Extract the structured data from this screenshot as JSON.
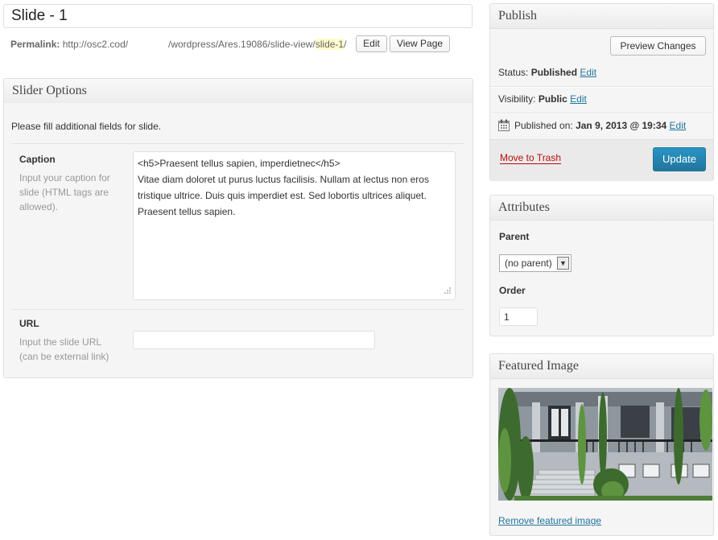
{
  "post": {
    "title": "Slide - 1",
    "permalink_label": "Permalink:",
    "permalink_base": "http://osc2.cod/",
    "permalink_path": "/wordpress/Ares.19086/slide-view/",
    "permalink_slug": "slide-1",
    "permalink_trail": "/",
    "edit_label": "Edit",
    "view_page_label": "View Page"
  },
  "slider_options": {
    "heading": "Slider Options",
    "intro": "Please fill additional fields for slide.",
    "caption_label": "Caption",
    "caption_help": "Input your caption for slide (HTML tags are allowed).",
    "caption_value": "<h5>Praesent tellus sapien, imperdietnec</h5>\nVitae diam doloret ut purus luctus facilisis. Nullam at lectus non eros tristique ultrice. Duis quis imperdiet est. Sed lobortis ultrices aliquet. Praesent tellus sapien.",
    "url_label": "URL",
    "url_help": "Input the slide URL (can be external link)",
    "url_value": ""
  },
  "publish": {
    "heading": "Publish",
    "preview_label": "Preview Changes",
    "status_label": "Status:",
    "status_value": "Published",
    "visibility_label": "Visibility:",
    "visibility_value": "Public",
    "published_label": "Published on:",
    "published_value": "Jan 9, 2013 @ 19:34",
    "edit_link": "Edit",
    "trash_label": "Move to Trash",
    "update_label": "Update"
  },
  "attributes": {
    "heading": "Attributes",
    "parent_label": "Parent",
    "parent_selected": "(no parent)",
    "order_label": "Order",
    "order_value": "1"
  },
  "featured_image": {
    "heading": "Featured Image",
    "remove_label": "Remove featured image"
  },
  "colors": {
    "link": "#21759b",
    "update_button": "#21759b",
    "trash": "#bc0b0b"
  },
  "icons": {
    "calendar": "calendar-icon",
    "dropdown": "chevron-down-icon",
    "resize": "resize-handle-icon"
  }
}
